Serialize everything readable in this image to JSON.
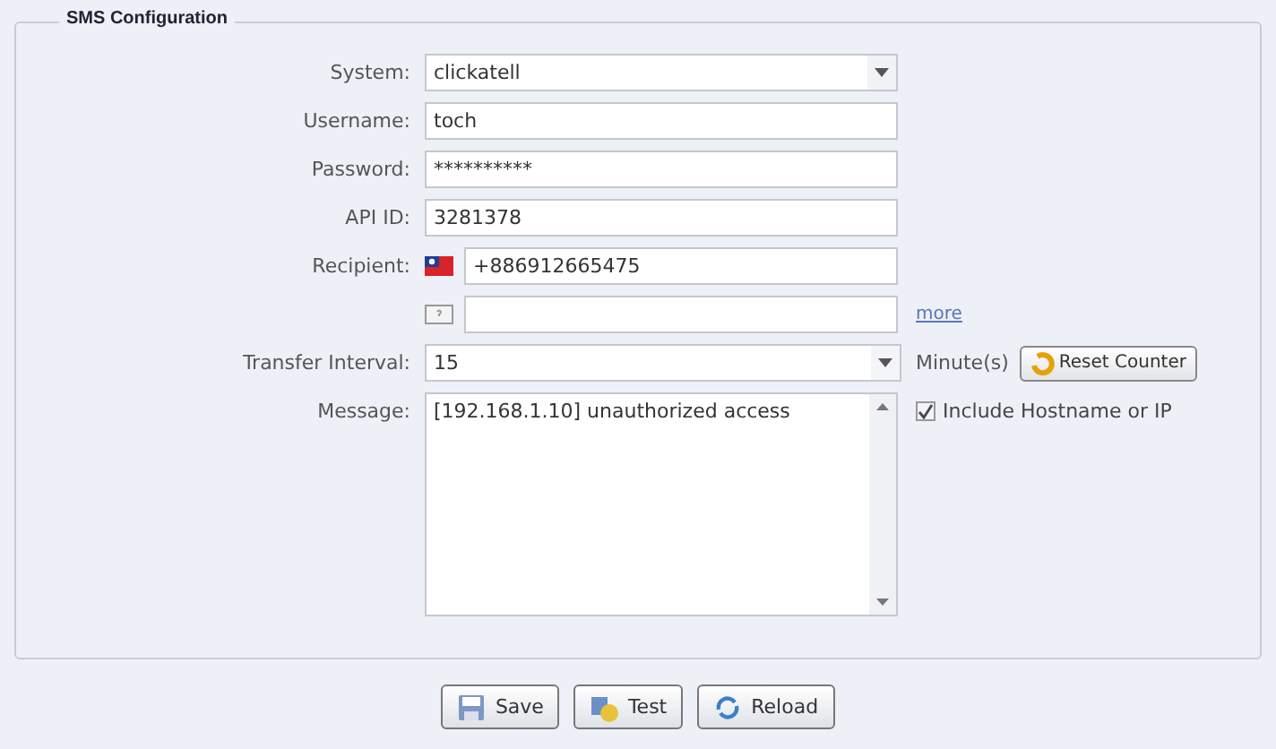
{
  "section": {
    "title": "SMS Configuration"
  },
  "fields": [
    {
      "kind": "select",
      "label": "System:",
      "value": "clickatell"
    },
    {
      "kind": "text",
      "label": "Username:",
      "value": "toch"
    },
    {
      "kind": "text",
      "label": "Password:",
      "value": "**********"
    },
    {
      "kind": "text",
      "label": "API ID:",
      "value": "3281378"
    },
    {
      "kind": "phone",
      "label": "Recipient:",
      "value": "+886912665475"
    },
    {
      "kind": "phone-extra",
      "link": "more"
    },
    {
      "kind": "interval",
      "label": "Transfer Interval:",
      "value": "15",
      "unit": "Minute(s)",
      "button": "Reset Counter"
    },
    {
      "kind": "message",
      "label": "Message:",
      "value": "[192.168.1.10] unauthorized access",
      "option": {
        "label": "Include Hostname or IP",
        "checked": true
      }
    }
  ],
  "buttons": [
    {
      "kind": "save",
      "label": "Save"
    },
    {
      "kind": "test",
      "label": "Test"
    },
    {
      "kind": "reload",
      "label": "Reload"
    }
  ]
}
